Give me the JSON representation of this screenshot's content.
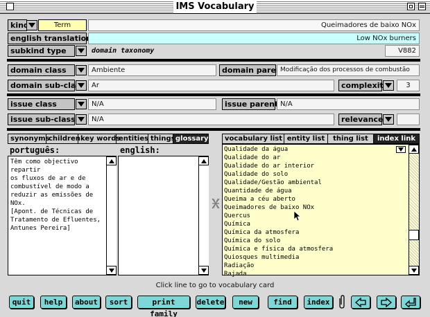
{
  "window": {
    "title": "IMS Vocabulary"
  },
  "kind": {
    "label": "kind",
    "value": "Term",
    "term": "Queimadores de baixo NOx"
  },
  "english_translation": {
    "label": "english translation",
    "value": "Low NOx burners"
  },
  "subkind": {
    "label": "subkind type",
    "value": "domain taxonomy",
    "code": "V882"
  },
  "domain_class": {
    "label": "domain class",
    "value": "Ambiente"
  },
  "domain_parent": {
    "label": "domain parent",
    "value": "Modificação dos processos de combustão"
  },
  "domain_subclass": {
    "label": "domain sub-class",
    "value": "Ar"
  },
  "complexity": {
    "label": "complexity",
    "value": "3"
  },
  "issue_class": {
    "label": "issue class",
    "value": "N/A"
  },
  "issue_parent": {
    "label": "issue parent",
    "value": "N/A"
  },
  "issue_subclass": {
    "label": "issue sub-class",
    "value": "N/A"
  },
  "relevance": {
    "label": "relevance",
    "value": ""
  },
  "left_tabs": [
    "synonyms",
    "children",
    "key words",
    "entities",
    "things",
    "glossary"
  ],
  "right_tabs": [
    "vocabulary list",
    "entity list",
    "thing list",
    "index link"
  ],
  "portugues": {
    "label": "português:",
    "lines": [
      "Têm como objectivo repartir",
      "os fluxos de ar e de",
      "combustível de modo a",
      "reduzir as emissões de NOx.",
      "[Apont. de Técnicas de",
      "Tratamento de Efluentes,",
      "Antunes Pereira]"
    ]
  },
  "english": {
    "label": "english:"
  },
  "vocab_list": [
    "Qualidade da água",
    "Qualidade do ar",
    "Qualidade do ar interior",
    "Qualidade do solo",
    "Qualidade/Gestão ambiental",
    "Quantidade de água",
    "Queima a céu aberto",
    "Queimadores de baixo NOx",
    "Quercus",
    "Química",
    "Química da atmosfera",
    "Química do solo",
    "Química e física da atmosfera",
    "Quiosques multimedia",
    "Radiação",
    "Rajada"
  ],
  "hint": "Click line to go to vocabulary card",
  "buttons": {
    "quit": "quit",
    "help": "help",
    "about": "about",
    "sort": "sort",
    "print_family": "print family",
    "delete": "delete",
    "new": "new",
    "find": "find",
    "index": "index"
  },
  "icons": {
    "paperclip": "paperclip-icon",
    "prev": "arrow-left-icon",
    "next": "arrow-right-icon",
    "return": "return-arrow-icon",
    "link": "link-icon"
  }
}
